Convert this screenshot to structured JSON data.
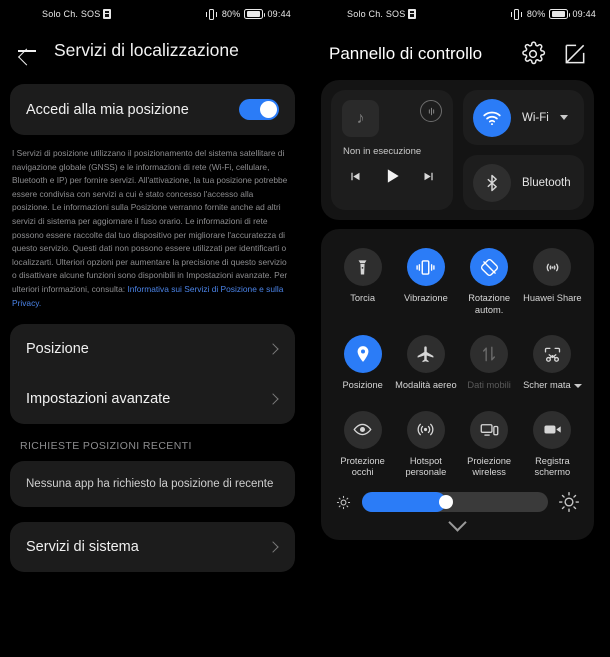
{
  "status_bar": {
    "carrier": "Solo Ch. SOS",
    "battery_percent": "80%",
    "time": "09:44",
    "sim_icon": "sim-card-icon",
    "vibrate_icon": "vibrate-icon",
    "battery_icon": "battery-icon"
  },
  "colors": {
    "accent_blue": "#2b7cf7",
    "link_blue": "#4b84e8",
    "card_bg": "#1c1c1c",
    "group_bg": "#141414",
    "tile_bg": "#1d1d1d",
    "inactive_circle": "#2e2e2e",
    "page_bg": "#000000"
  },
  "left_panel": {
    "back_icon": "back-arrow-icon",
    "title": "Servizi di localizzazione",
    "access_row": {
      "label": "Accedi alla mia posizione",
      "toggle_state": "on"
    },
    "legal_text": "I Servizi di posizione utilizzano il posizionamento del sistema satellitare di navigazione globale (GNSS) e le informazioni di rete (Wi-Fi, cellulare, Bluetooth e IP) per fornire servizi. All'attivazione, la tua posizione potrebbe essere condivisa con servizi a cui è stato concesso l'accesso alla posizione. Le informazioni sulla Posizione verranno fornite anche ad altri servizi di sistema per aggiornare il fuso orario. Le informazioni di rete possono essere raccolte dal tuo dispositivo per migliorare l'accuratezza di questo servizio. Questi dati non possono essere utilizzati per identificarti o localizzarti. Ulteriori opzioni per aumentare la precisione di questo servizio o disattivare alcune funzioni sono disponibili in Impostazioni avanzate. Per ulteriori informazioni, consulta: ",
    "legal_link": "Informativa sui Servizi di Posizione e sulla Privacy.",
    "menu_items": [
      {
        "label": "Posizione"
      },
      {
        "label": "Impostazioni avanzate"
      }
    ],
    "section_header": "RICHIESTE POSIZIONI RECENTI",
    "empty_state": "Nessuna app ha richiesto la posizione di recente",
    "system_services": {
      "label": "Servizi di sistema"
    }
  },
  "right_panel": {
    "title": "Pannello di controllo",
    "header_icons": [
      {
        "name": "gear-icon"
      },
      {
        "name": "edit-square-icon"
      }
    ],
    "media": {
      "album_icon": "music-note-icon",
      "cast_icon": "cast-audio-icon",
      "status": "Non in esecuzione",
      "prev_icon": "skip-previous-icon",
      "play_icon": "play-icon",
      "next_icon": "skip-next-icon"
    },
    "connectivity": [
      {
        "label": "Wi-Fi",
        "icon": "wifi-icon",
        "state": "on",
        "has_caret": true
      },
      {
        "label": "Bluetooth",
        "icon": "bluetooth-icon",
        "state": "off",
        "has_caret": false
      }
    ],
    "toggles": [
      {
        "label": "Torcia",
        "icon": "flashlight-icon",
        "state": "off",
        "disabled": false,
        "caret": false
      },
      {
        "label": "Vibrazione",
        "icon": "vibration-icon",
        "state": "on",
        "disabled": false,
        "caret": false
      },
      {
        "label": "Rotazione autom.",
        "icon": "auto-rotate-icon",
        "state": "on",
        "disabled": false,
        "caret": false
      },
      {
        "label": "Huawei Share",
        "icon": "huawei-share-icon",
        "state": "off",
        "disabled": false,
        "caret": false
      },
      {
        "label": "Posizione",
        "icon": "location-pin-icon",
        "state": "on",
        "disabled": false,
        "caret": false
      },
      {
        "label": "Modalità aereo",
        "icon": "airplane-icon",
        "state": "off",
        "disabled": false,
        "caret": false
      },
      {
        "label": "Dati mobili",
        "icon": "mobile-data-icon",
        "state": "off",
        "disabled": true,
        "caret": false
      },
      {
        "label": "Scher mata",
        "icon": "screenshot-icon",
        "state": "off",
        "disabled": false,
        "caret": true
      },
      {
        "label": "Protezione occhi",
        "icon": "eye-comfort-icon",
        "state": "off",
        "disabled": false,
        "caret": false
      },
      {
        "label": "Hotspot personale",
        "icon": "hotspot-icon",
        "state": "off",
        "disabled": false,
        "caret": false
      },
      {
        "label": "Proiezione wireless",
        "icon": "wireless-projection-icon",
        "state": "off",
        "disabled": false,
        "caret": false
      },
      {
        "label": "Registra schermo",
        "icon": "screen-record-icon",
        "state": "off",
        "disabled": false,
        "caret": false
      }
    ],
    "brightness": {
      "value_percent": 45,
      "low_icon": "brightness-low-icon",
      "high_icon": "brightness-high-icon",
      "collapse_icon": "chevron-down-icon"
    }
  }
}
